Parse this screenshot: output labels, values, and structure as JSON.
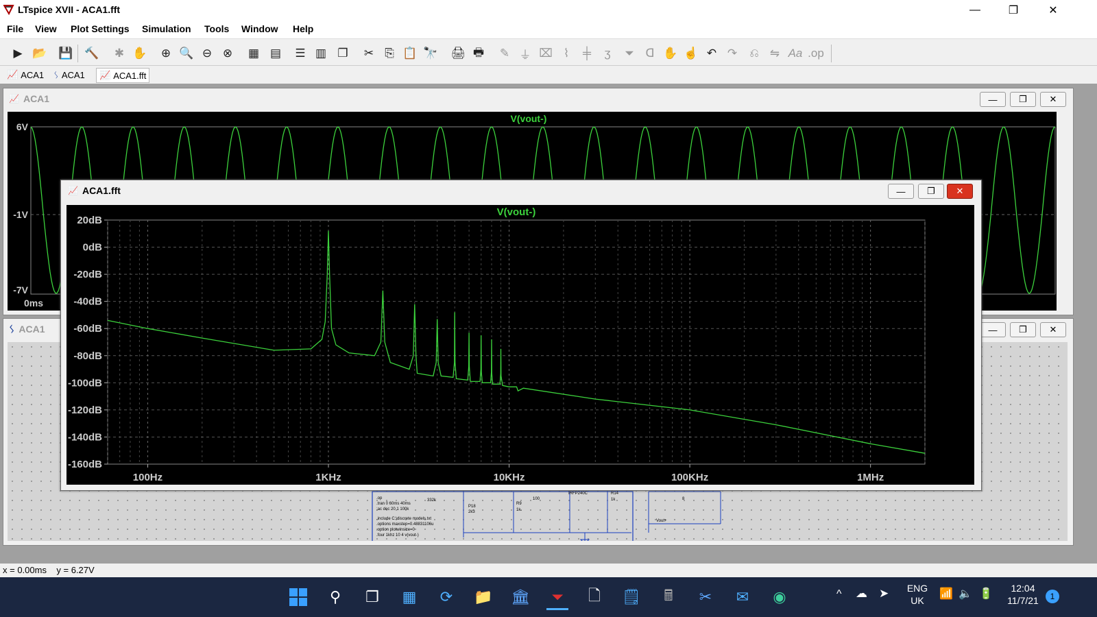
{
  "app": {
    "title": "LTspice XVII - ACA1.fft"
  },
  "window_controls": {
    "minimize": "—",
    "restore": "❐",
    "close": "✕"
  },
  "menu": [
    "File",
    "View",
    "Plot Settings",
    "Simulation",
    "Tools",
    "Window",
    "Help"
  ],
  "doc_tabs": [
    {
      "label": "ACA1",
      "icon": "waveform-icon"
    },
    {
      "label": "ACA1",
      "icon": "schematic-icon"
    },
    {
      "label": "ACA1.fft",
      "icon": "waveform-icon"
    }
  ],
  "waveform_window": {
    "title": "ACA1",
    "trace": "V(vout-)",
    "y_labels": [
      "6V",
      "-1V",
      "-7V"
    ],
    "x_label": "0ms"
  },
  "schematic_window": {
    "title": "ACA1",
    "directives": [
      ".op",
      ".tran 0 60ms 40ms",
      ";ac dec 20 1 100k",
      ".include C:\\discrete models.txt",
      ".options maxstep=0.48831106u",
      ".option plotwinsize=0",
      ".four 1khz 10 4 v(vout-)"
    ],
    "parts": [
      "332k",
      "P18",
      "2k3",
      "R9",
      "1k.",
      "100",
      "IRFP240C",
      "R14",
      "1k",
      "Vout+",
      "8"
    ]
  },
  "fft_window": {
    "title": "ACA1.fft",
    "trace": "V(vout-)"
  },
  "chart_data": {
    "type": "line",
    "title": "V(vout-)",
    "xscale": "log",
    "xlim": [
      60,
      2000000
    ],
    "ylim": [
      -160,
      20
    ],
    "y_ticks": [
      "20dB",
      "0dB",
      "-20dB",
      "-40dB",
      "-60dB",
      "-80dB",
      "-100dB",
      "-120dB",
      "-140dB",
      "-160dB"
    ],
    "x_ticks": [
      {
        "v": 100,
        "label": "100Hz"
      },
      {
        "v": 1000,
        "label": "1KHz"
      },
      {
        "v": 10000,
        "label": "10KHz"
      },
      {
        "v": 100000,
        "label": "100KHz"
      },
      {
        "v": 1000000,
        "label": "1MHz"
      }
    ],
    "grid": true,
    "series": [
      {
        "color": "#3cd23c",
        "points": [
          [
            60,
            -54
          ],
          [
            100,
            -60
          ],
          [
            200,
            -67
          ],
          [
            500,
            -76
          ],
          [
            800,
            -75
          ],
          [
            920,
            -68
          ],
          [
            960,
            -55
          ],
          [
            985,
            -20
          ],
          [
            1000,
            12
          ],
          [
            1015,
            -20
          ],
          [
            1040,
            -60
          ],
          [
            1100,
            -72
          ],
          [
            1300,
            -78
          ],
          [
            1800,
            -80
          ],
          [
            1950,
            -70
          ],
          [
            2000,
            -32
          ],
          [
            2050,
            -70
          ],
          [
            2200,
            -85
          ],
          [
            2800,
            -90
          ],
          [
            2950,
            -80
          ],
          [
            3000,
            -42
          ],
          [
            3050,
            -80
          ],
          [
            3100,
            -93
          ],
          [
            3800,
            -95
          ],
          [
            3950,
            -85
          ],
          [
            4000,
            -53
          ],
          [
            4050,
            -85
          ],
          [
            4200,
            -95
          ],
          [
            4900,
            -96
          ],
          [
            4980,
            -85
          ],
          [
            5000,
            -48
          ],
          [
            5020,
            -85
          ],
          [
            5100,
            -97
          ],
          [
            5900,
            -98
          ],
          [
            5980,
            -88
          ],
          [
            6000,
            -63
          ],
          [
            6020,
            -88
          ],
          [
            6100,
            -99
          ],
          [
            6900,
            -99
          ],
          [
            6980,
            -90
          ],
          [
            7000,
            -65
          ],
          [
            7020,
            -92
          ],
          [
            7100,
            -100
          ],
          [
            7900,
            -100
          ],
          [
            7980,
            -92
          ],
          [
            8000,
            -68
          ],
          [
            8020,
            -93
          ],
          [
            8100,
            -101
          ],
          [
            8900,
            -101
          ],
          [
            8980,
            -93
          ],
          [
            9000,
            -75
          ],
          [
            9020,
            -95
          ],
          [
            9200,
            -102
          ],
          [
            10000,
            -103
          ],
          [
            11000,
            -103
          ],
          [
            11200,
            -106
          ],
          [
            12000,
            -104
          ],
          [
            30000,
            -112
          ],
          [
            100000,
            -120
          ],
          [
            300000,
            -131
          ],
          [
            1000000,
            -145
          ],
          [
            2000000,
            -152
          ]
        ]
      }
    ]
  },
  "status_bar": {
    "text": "x = 0.00ms    y = 6.27V"
  },
  "taskbar": {
    "lang_top": "ENG",
    "lang_bottom": "UK",
    "time": "12:04",
    "date": "11/7/21",
    "notification_count": "1"
  }
}
